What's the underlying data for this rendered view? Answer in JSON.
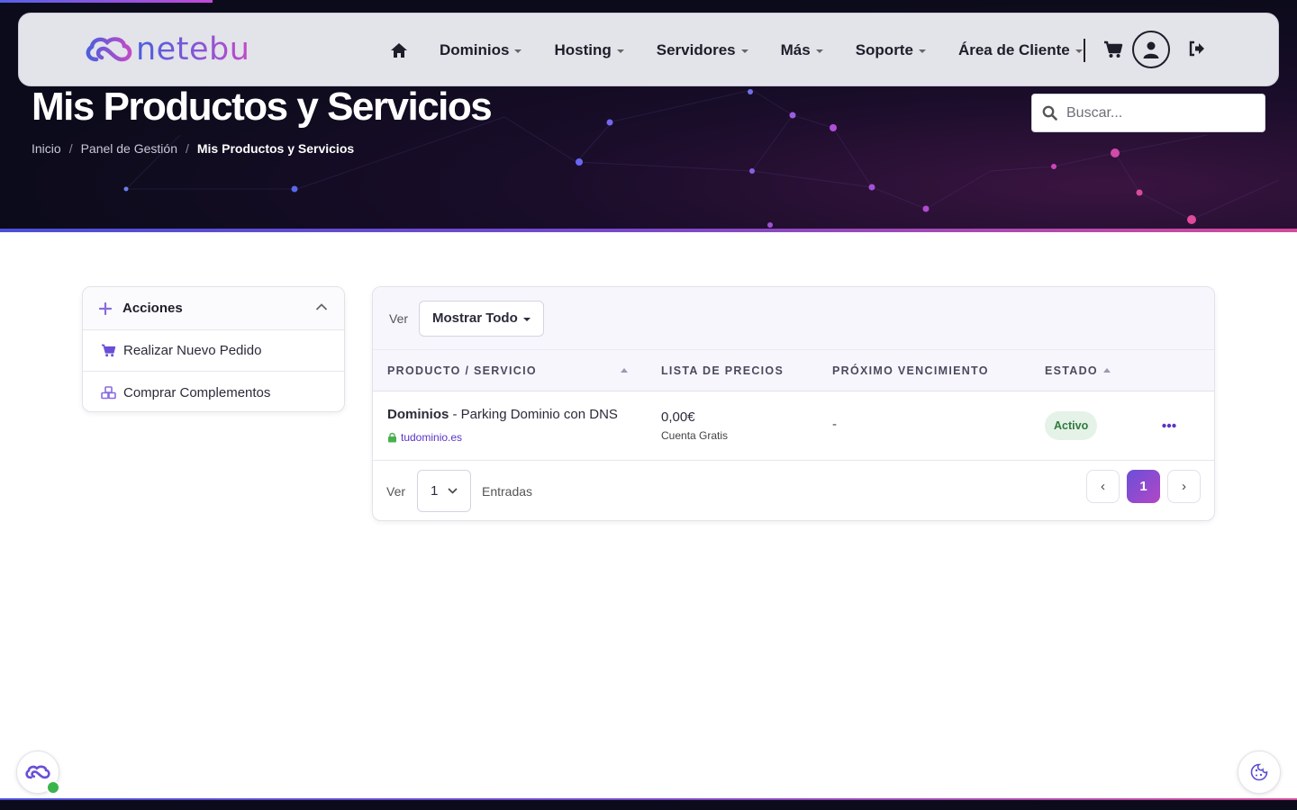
{
  "brand": {
    "name": "netebu"
  },
  "nav": {
    "items": [
      {
        "label": "Dominios"
      },
      {
        "label": "Hosting"
      },
      {
        "label": "Servidores"
      },
      {
        "label": "Más"
      },
      {
        "label": "Soporte"
      },
      {
        "label": "Área de Cliente"
      }
    ]
  },
  "header": {
    "title": "Mis Productos y Servicios",
    "breadcrumb": [
      "Inicio",
      "Panel de Gestión",
      "Mis Productos y Servicios"
    ],
    "search_placeholder": "Buscar..."
  },
  "sidebar": {
    "title": "Acciones",
    "items": [
      {
        "label": "Realizar Nuevo Pedido",
        "icon": "cart-icon"
      },
      {
        "label": "Comprar Complementos",
        "icon": "cubes-icon"
      }
    ]
  },
  "table": {
    "filter_prefix": "Ver",
    "filter_value": "Mostrar Todo",
    "columns": [
      "PRODUCTO / SERVICIO",
      "LISTA DE PRECIOS",
      "PRÓXIMO VENCIMIENTO",
      "ESTADO"
    ],
    "rows": [
      {
        "category": "Dominios",
        "product": " - Parking Dominio con DNS",
        "domain": "tudominio.es",
        "price": "0,00€",
        "billing": "Cuenta Gratis",
        "due": "-",
        "status": "Activo"
      }
    ],
    "length_prefix": "Ver",
    "length_value": "1",
    "length_suffix": "Entradas",
    "pagination": {
      "prev": "‹",
      "current": "1",
      "next": "›"
    }
  },
  "colors": {
    "accent": "#6a4fd8",
    "accent2": "#c14bc7",
    "status_active_bg": "#e5f2e7",
    "status_active_text": "#2f7a3e"
  }
}
